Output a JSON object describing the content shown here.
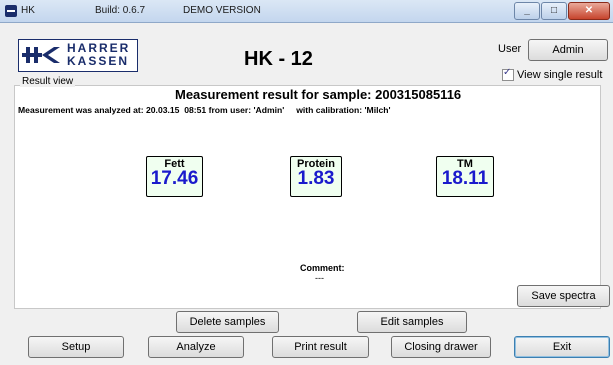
{
  "titlebar": {
    "app_name": "HK",
    "build": "Build: 0.6.7",
    "version_note": "DEMO VERSION"
  },
  "logo": {
    "line1": "HARRER",
    "line2": "KASSEN"
  },
  "app_title": "HK - 12",
  "user": {
    "label": "User",
    "button": "Admin"
  },
  "view_single_result": {
    "label": "View single result",
    "checked": true
  },
  "result_view": {
    "group_label": "Result view",
    "title": "Measurement result for sample: 200315085116",
    "info": "Measurement was analyzed at: 20.03.15  08:51 from user: 'Admin'     with calibration: 'Milch'",
    "results": [
      {
        "name": "Fett",
        "value": "17.46"
      },
      {
        "name": "Protein",
        "value": "1.83"
      },
      {
        "name": "TM",
        "value": "18.11"
      }
    ],
    "comment_label": "Comment:",
    "comment_value": "---"
  },
  "buttons": {
    "save_spectra": "Save spectra",
    "delete_samples": "Delete samples",
    "edit_samples": "Edit samples",
    "setup": "Setup",
    "analyze": "Analyze",
    "print_result": "Print result",
    "closing_drawer": "Closing drawer",
    "exit": "Exit"
  },
  "colors": {
    "value_text": "#1a1acc",
    "result_bg": "#f0fff0",
    "logo": "#1a2d6b"
  }
}
